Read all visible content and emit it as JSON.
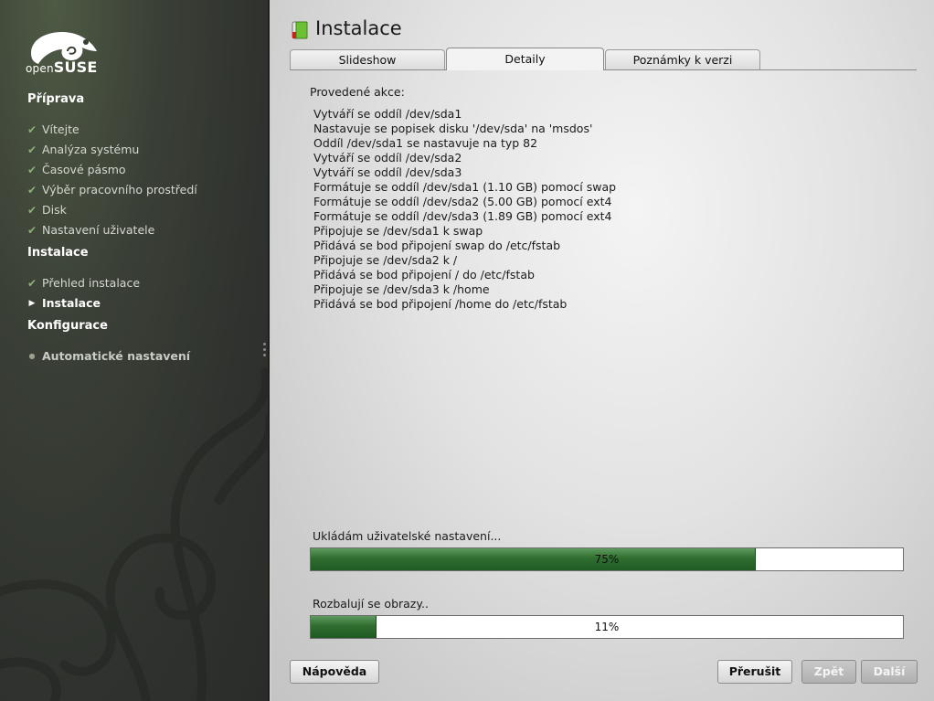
{
  "brand": {
    "open": "open",
    "suse": "SUSE"
  },
  "sidebar": {
    "sections": [
      {
        "title": "Příprava",
        "items": [
          {
            "label": "Vítejte",
            "state": "done"
          },
          {
            "label": "Analýza systému",
            "state": "done"
          },
          {
            "label": "Časové pásmo",
            "state": "done"
          },
          {
            "label": "Výběr pracovního prostředí",
            "state": "done"
          },
          {
            "label": "Disk",
            "state": "done"
          },
          {
            "label": "Nastavení uživatele",
            "state": "done"
          }
        ]
      },
      {
        "title": "Instalace",
        "items": [
          {
            "label": "Přehled instalace",
            "state": "done"
          },
          {
            "label": "Instalace",
            "state": "current"
          }
        ]
      },
      {
        "title": "Konfigurace",
        "items": [
          {
            "label": "Automatické nastavení",
            "state": "pending"
          }
        ]
      }
    ],
    "marks": {
      "done": "✔",
      "current": "▶",
      "pending": "●"
    }
  },
  "main": {
    "title": "Instalace",
    "tabs": [
      {
        "label": "Slideshow",
        "active": false
      },
      {
        "label": "Detaily",
        "active": true
      },
      {
        "label": "Poznámky k verzi",
        "active": false
      }
    ],
    "actions_label": "Provedené akce:",
    "log": [
      "Vytváří se oddíl /dev/sda1",
      "Nastavuje se popisek disku '/dev/sda' na 'msdos'",
      "Oddíl /dev/sda1 se nastavuje na typ 82",
      "Vytváří se oddíl /dev/sda2",
      "Vytváří se oddíl /dev/sda3",
      "Formátuje se oddíl /dev/sda1 (1.10 GB) pomocí swap",
      "Formátuje se oddíl /dev/sda2 (5.00 GB) pomocí ext4",
      "Formátuje se oddíl /dev/sda3 (1.89 GB) pomocí ext4",
      "Připojuje se /dev/sda1 k swap",
      "Přidává se bod připojení swap do /etc/fstab",
      "Připojuje se /dev/sda2 k /",
      "Přidává se bod připojení / do /etc/fstab",
      "Připojuje se /dev/sda3 k /home",
      "Přidává se bod připojení /home do /etc/fstab"
    ],
    "progress": [
      {
        "label": "Ukládám uživatelské nastavení...",
        "value": 75,
        "text": "75%"
      },
      {
        "label": "Rozbalují se obrazy..",
        "value": 11,
        "text": "11%"
      }
    ]
  },
  "buttons": {
    "help": "Nápověda",
    "abort": "Přerušit",
    "back": "Zpět",
    "next": "Další"
  },
  "colors": {
    "accent": "#2f6e2f",
    "sidebar": "#2f322e"
  }
}
